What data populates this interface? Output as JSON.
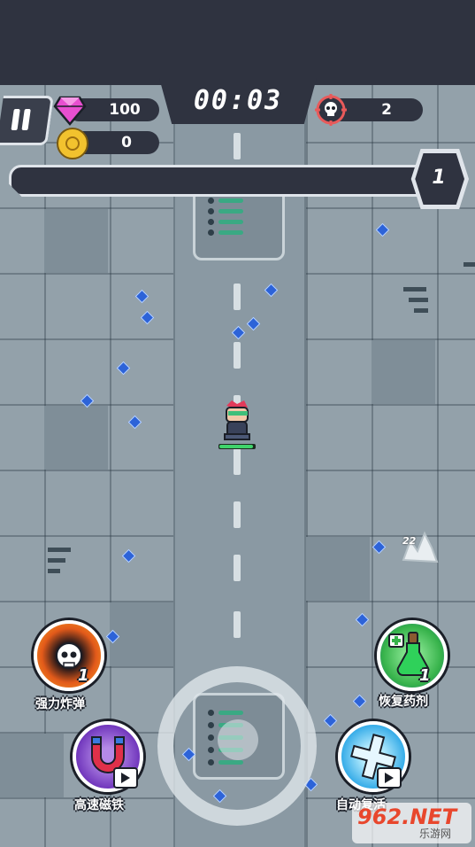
{
  "hud": {
    "timer": "00:03",
    "gems": "100",
    "coins": "0",
    "kills": "2",
    "level": "1",
    "xp_progress": 0.0,
    "player_hp_fraction": 0.95
  },
  "floating_damage": "22",
  "skills": [
    {
      "id": "bomb",
      "label": "强力炸弹",
      "count": "1",
      "color": "#e35a1a"
    },
    {
      "id": "potion",
      "label": "恢复药剂",
      "count": "1",
      "color": "#36b24a"
    },
    {
      "id": "magnet",
      "label": "高速磁铁",
      "video": true,
      "color": "#6a2fb8"
    },
    {
      "id": "revive",
      "label": "自动复活",
      "video": true,
      "color": "#2aa6e6"
    }
  ],
  "watermark": {
    "main": "962.NET",
    "sub": "乐游网"
  },
  "colors": {
    "hud_dark": "#2f3340",
    "gem": "#2d63d8",
    "hp": "#3fd36b"
  }
}
